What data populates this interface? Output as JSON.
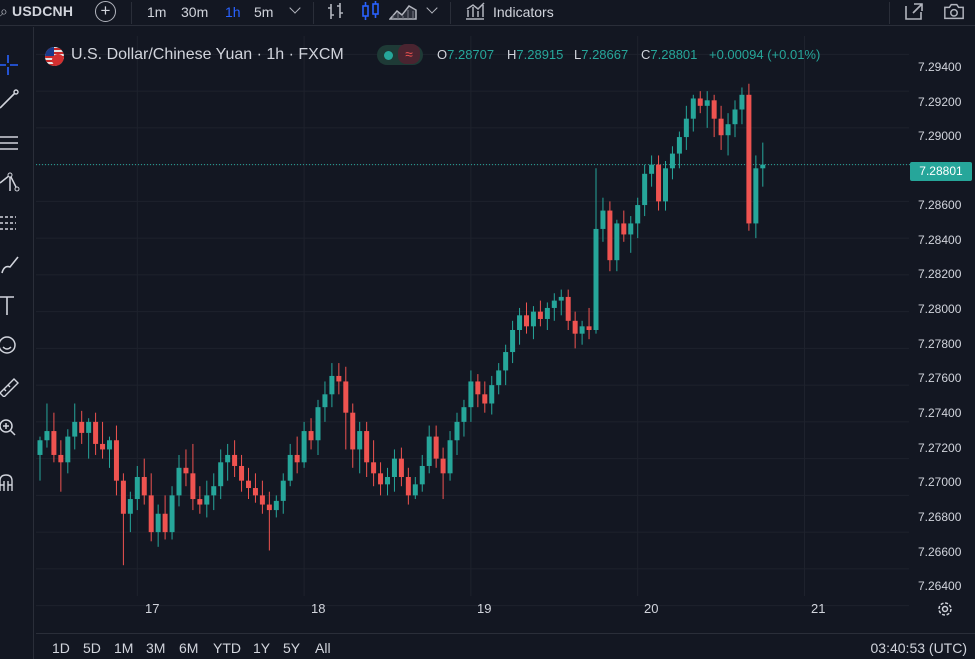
{
  "toolbar": {
    "symbol": "USDCNH",
    "intervals": [
      "1m",
      "30m",
      "1h",
      "5m"
    ],
    "active_interval": "1h",
    "indicators_label": "Indicators"
  },
  "legend": {
    "title": "U.S. Dollar/Chinese Yuan · 1h · FXCM",
    "open_key": "O",
    "open": "7.28707",
    "high_key": "H",
    "high": "7.28915",
    "low_key": "L",
    "low": "7.28667",
    "close_key": "C",
    "close": "7.28801",
    "change": "+0.00094 (+0.01%)",
    "wave_glyph": "≈"
  },
  "price_axis": {
    "labels": [
      "7.29400",
      "7.29200",
      "7.29000",
      "7.28600",
      "7.28400",
      "7.28200",
      "7.28000",
      "7.27800",
      "7.27600",
      "7.27400",
      "7.27200",
      "7.27000",
      "7.26800",
      "7.26600",
      "7.26400"
    ],
    "current_price": "7.28801"
  },
  "time_axis": {
    "labels": [
      "17",
      "18",
      "19",
      "20",
      "21"
    ]
  },
  "range_buttons": [
    "1D",
    "5D",
    "1M",
    "3M",
    "6M",
    "YTD",
    "1Y",
    "5Y",
    "All"
  ],
  "clock": "03:40:53 (UTC)",
  "colors": {
    "up": "#26a69a",
    "down": "#ef5350",
    "background": "#131722",
    "grid": "#1e222d",
    "accent": "#2962ff"
  },
  "chart_data": {
    "type": "candlestick",
    "symbol": "USDCNH",
    "interval": "1h",
    "ylim": [
      7.263,
      7.295
    ],
    "x_labels": [
      "17",
      "18",
      "19",
      "20",
      "21"
    ],
    "x_label_bar_index": [
      14,
      38,
      62,
      86,
      110
    ],
    "candles": [
      [
        7.2722,
        7.2732,
        7.2708,
        7.273
      ],
      [
        7.273,
        7.275,
        7.2726,
        7.2735
      ],
      [
        7.2735,
        7.2745,
        7.2718,
        7.2722
      ],
      [
        7.2722,
        7.273,
        7.2702,
        7.2718
      ],
      [
        7.2718,
        7.2736,
        7.2712,
        7.2732
      ],
      [
        7.2732,
        7.275,
        7.2725,
        7.274
      ],
      [
        7.274,
        7.2746,
        7.2728,
        7.2734
      ],
      [
        7.2734,
        7.2742,
        7.272,
        7.274
      ],
      [
        7.274,
        7.2745,
        7.2722,
        7.2728
      ],
      [
        7.2728,
        7.274,
        7.272,
        7.2725
      ],
      [
        7.2725,
        7.2732,
        7.2715,
        7.273
      ],
      [
        7.273,
        7.2738,
        7.27,
        7.2708
      ],
      [
        7.2708,
        7.2712,
        7.2662,
        7.269
      ],
      [
        7.269,
        7.2702,
        7.268,
        7.2698
      ],
      [
        7.2698,
        7.2716,
        7.2692,
        7.271
      ],
      [
        7.271,
        7.272,
        7.2695,
        7.27
      ],
      [
        7.27,
        7.2712,
        7.2675,
        7.268
      ],
      [
        7.268,
        7.2695,
        7.2672,
        7.269
      ],
      [
        7.269,
        7.27,
        7.2676,
        7.268
      ],
      [
        7.268,
        7.2705,
        7.2676,
        7.27
      ],
      [
        7.27,
        7.2722,
        7.2694,
        7.2715
      ],
      [
        7.2715,
        7.2725,
        7.2705,
        7.2712
      ],
      [
        7.2712,
        7.2728,
        7.2692,
        7.2698
      ],
      [
        7.2698,
        7.2705,
        7.269,
        7.2695
      ],
      [
        7.2695,
        7.2708,
        7.2688,
        7.27
      ],
      [
        7.27,
        7.2712,
        7.2692,
        7.2705
      ],
      [
        7.2705,
        7.2725,
        7.2698,
        7.2718
      ],
      [
        7.2718,
        7.2728,
        7.2708,
        7.2722
      ],
      [
        7.2722,
        7.273,
        7.271,
        7.2716
      ],
      [
        7.2716,
        7.2722,
        7.2702,
        7.2708
      ],
      [
        7.2708,
        7.2715,
        7.2698,
        7.2704
      ],
      [
        7.2704,
        7.2712,
        7.2696,
        7.27
      ],
      [
        7.27,
        7.2708,
        7.269,
        7.2695
      ],
      [
        7.2695,
        7.2702,
        7.267,
        7.2692
      ],
      [
        7.2692,
        7.27,
        7.2688,
        7.2697
      ],
      [
        7.2697,
        7.2712,
        7.269,
        7.2708
      ],
      [
        7.2708,
        7.2728,
        7.2705,
        7.2722
      ],
      [
        7.2722,
        7.2732,
        7.2712,
        7.2718
      ],
      [
        7.2718,
        7.274,
        7.2715,
        7.2735
      ],
      [
        7.2735,
        7.2742,
        7.2725,
        7.273
      ],
      [
        7.273,
        7.2752,
        7.2722,
        7.2748
      ],
      [
        7.2748,
        7.2762,
        7.274,
        7.2755
      ],
      [
        7.2755,
        7.2772,
        7.2748,
        7.2765
      ],
      [
        7.2765,
        7.2772,
        7.2755,
        7.2762
      ],
      [
        7.2762,
        7.277,
        7.2725,
        7.2745
      ],
      [
        7.2745,
        7.275,
        7.2715,
        7.2725
      ],
      [
        7.2725,
        7.274,
        7.2712,
        7.2735
      ],
      [
        7.2735,
        7.274,
        7.271,
        7.2718
      ],
      [
        7.2718,
        7.273,
        7.2705,
        7.2712
      ],
      [
        7.2712,
        7.2718,
        7.27,
        7.2706
      ],
      [
        7.2706,
        7.2715,
        7.27,
        7.271
      ],
      [
        7.271,
        7.2725,
        7.2702,
        7.272
      ],
      [
        7.272,
        7.2726,
        7.2705,
        7.271
      ],
      [
        7.271,
        7.2715,
        7.2695,
        7.27
      ],
      [
        7.27,
        7.271,
        7.2698,
        7.2706
      ],
      [
        7.2706,
        7.2722,
        7.2702,
        7.2716
      ],
      [
        7.2716,
        7.2738,
        7.2712,
        7.2732
      ],
      [
        7.2732,
        7.2738,
        7.2715,
        7.272
      ],
      [
        7.272,
        7.2726,
        7.2698,
        7.2712
      ],
      [
        7.2712,
        7.2735,
        7.2708,
        7.273
      ],
      [
        7.273,
        7.2745,
        7.2722,
        7.274
      ],
      [
        7.274,
        7.2752,
        7.2732,
        7.2748
      ],
      [
        7.2748,
        7.2768,
        7.274,
        7.2762
      ],
      [
        7.2762,
        7.2766,
        7.2748,
        7.2755
      ],
      [
        7.2755,
        7.2762,
        7.2745,
        7.275
      ],
      [
        7.275,
        7.2765,
        7.2744,
        7.276
      ],
      [
        7.276,
        7.2772,
        7.2755,
        7.2768
      ],
      [
        7.2768,
        7.2782,
        7.276,
        7.2778
      ],
      [
        7.2778,
        7.2795,
        7.2772,
        7.279
      ],
      [
        7.279,
        7.2802,
        7.2782,
        7.2798
      ],
      [
        7.2798,
        7.2805,
        7.2788,
        7.2792
      ],
      [
        7.2792,
        7.2803,
        7.2785,
        7.28
      ],
      [
        7.28,
        7.2806,
        7.2792,
        7.2796
      ],
      [
        7.2796,
        7.2805,
        7.279,
        7.2802
      ],
      [
        7.2802,
        7.281,
        7.2795,
        7.2806
      ],
      [
        7.2806,
        7.2812,
        7.2798,
        7.2808
      ],
      [
        7.2808,
        7.2812,
        7.279,
        7.2795
      ],
      [
        7.2795,
        7.28,
        7.278,
        7.2788
      ],
      [
        7.2788,
        7.2795,
        7.2782,
        7.2792
      ],
      [
        7.2792,
        7.2802,
        7.2785,
        7.279
      ],
      [
        7.279,
        7.2878,
        7.2788,
        7.2845
      ],
      [
        7.2845,
        7.2862,
        7.2838,
        7.2855
      ],
      [
        7.2855,
        7.286,
        7.2822,
        7.2828
      ],
      [
        7.2828,
        7.285,
        7.2822,
        7.2848
      ],
      [
        7.2848,
        7.2855,
        7.2838,
        7.2842
      ],
      [
        7.2842,
        7.2852,
        7.2832,
        7.2848
      ],
      [
        7.2848,
        7.2862,
        7.284,
        7.2858
      ],
      [
        7.2858,
        7.288,
        7.2852,
        7.2875
      ],
      [
        7.2875,
        7.2885,
        7.2868,
        7.288
      ],
      [
        7.288,
        7.2885,
        7.2855,
        7.286
      ],
      [
        7.286,
        7.2882,
        7.2855,
        7.2878
      ],
      [
        7.2878,
        7.289,
        7.2872,
        7.2886
      ],
      [
        7.2886,
        7.2898,
        7.2878,
        7.2895
      ],
      [
        7.2895,
        7.2912,
        7.2888,
        7.2905
      ],
      [
        7.2905,
        7.2918,
        7.2898,
        7.2916
      ],
      [
        7.2916,
        7.292,
        7.2908,
        7.2912
      ],
      [
        7.2912,
        7.292,
        7.29,
        7.2915
      ],
      [
        7.2915,
        7.2918,
        7.2895,
        7.2905
      ],
      [
        7.2905,
        7.2912,
        7.2888,
        7.2896
      ],
      [
        7.2896,
        7.2908,
        7.2885,
        7.2902
      ],
      [
        7.2902,
        7.2915,
        7.2895,
        7.291
      ],
      [
        7.291,
        7.2922,
        7.2902,
        7.2918
      ],
      [
        7.2918,
        7.2924,
        7.2844,
        7.2848
      ],
      [
        7.2848,
        7.2885,
        7.284,
        7.2878
      ],
      [
        7.2878,
        7.2892,
        7.2868,
        7.288
      ]
    ]
  }
}
